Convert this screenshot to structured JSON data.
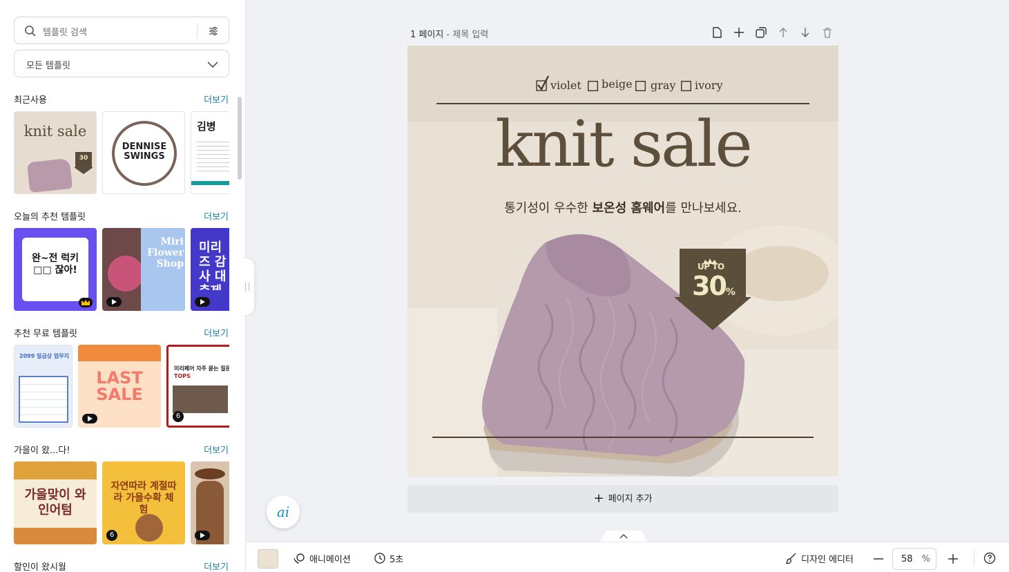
{
  "sidebar": {
    "search_placeholder": "템플릿 검색",
    "filter_value": "모든 템플릿",
    "sections": [
      {
        "title": "최근사용",
        "more": "더보기"
      },
      {
        "title": "오늘의 추천 템플릿",
        "more": "더보기"
      },
      {
        "title": "추천 무료 템플릿",
        "more": "더보기"
      },
      {
        "title": "가을이 왔...다!",
        "more": "더보기"
      },
      {
        "title": "할인이 왔시월",
        "more": "더보기"
      }
    ],
    "thumbs": {
      "knit_title": "knit sale",
      "knit_pct": "30",
      "dennise": "DENNISE SWINGS",
      "kim_title": "김병",
      "wan_text": "완~전 럭키□□ 잖아!",
      "miri_flower": "Miri Flower Shop",
      "miri_thanks": "미리즈 감사 대축제",
      "plan": "2099 일급상 업무지",
      "last_sale": "LAST SALE",
      "faq_title": "미리페어 자주 묻는 질문",
      "faq_sub": "TOPS",
      "wine": "가을맞이 와인어텀",
      "harvest": "자연따라 계절따라 가을수확 체험",
      "badge_6": "6"
    }
  },
  "canvas": {
    "page_label": "1 페이지",
    "page_sub": " - 제목 입력",
    "add_page": "페이지 추가",
    "ai_label": "ai"
  },
  "design": {
    "options": [
      "violet",
      "beige",
      "gray",
      "ivory"
    ],
    "title": "knit sale",
    "subtitle_pre": "통기성이 우수한 ",
    "subtitle_bold": "보온성 홈웨어",
    "subtitle_post": "를 만나보세요.",
    "badge_up": "UP TO",
    "badge_value": "30",
    "badge_pct": "%"
  },
  "bottom": {
    "animation": "애니메이션",
    "duration": "5초",
    "design_editor": "디자인 에디터",
    "zoom": "58",
    "zoom_unit": "%"
  },
  "colors": {
    "accent": "#1a7fa3",
    "bg_color": "#ece2d2",
    "title_brown": "#5e4f3c",
    "badge_brown": "#5b4e3b",
    "badge_text": "#f0eac3"
  }
}
